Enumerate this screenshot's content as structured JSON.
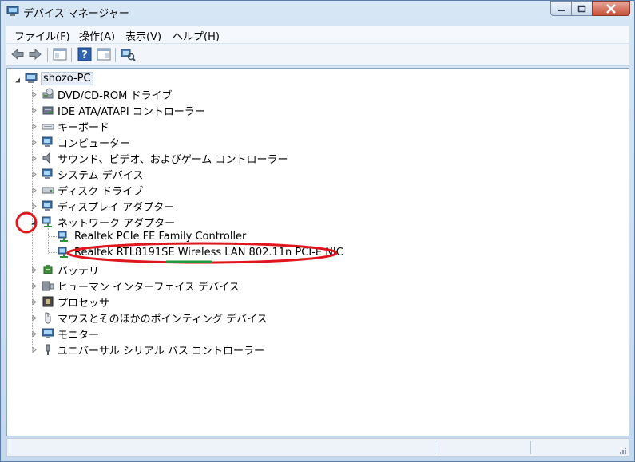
{
  "window": {
    "title": "デバイス マネージャー"
  },
  "menu": [
    "ファイル(F)",
    "操作(A)",
    "表示(V)",
    "ヘルプ(H)"
  ],
  "tree": {
    "root": "shozo-PC",
    "categories": [
      "DVD/CD-ROM ドライブ",
      "IDE ATA/ATAPI コントローラー",
      "キーボード",
      "コンピューター",
      "サウンド、ビデオ、およびゲーム コントローラー",
      "システム デバイス",
      "ディスク ドライブ",
      "ディスプレイ アダプター",
      "ネットワーク アダプター",
      "バッテリ",
      "ヒューマン インターフェイス デバイス",
      "プロセッサ",
      "マウスとそのほかのポインティング デバイス",
      "モニター",
      "ユニバーサル シリアル バス コントローラー"
    ],
    "network_children": [
      "Realtek PCIe FE Family Controller",
      "Realtek RTL8191SE Wireless LAN 802.11n PCI-E NIC"
    ]
  },
  "annotation_colors": {
    "circle": "#e0161e",
    "underline": "#1c9b3c"
  }
}
